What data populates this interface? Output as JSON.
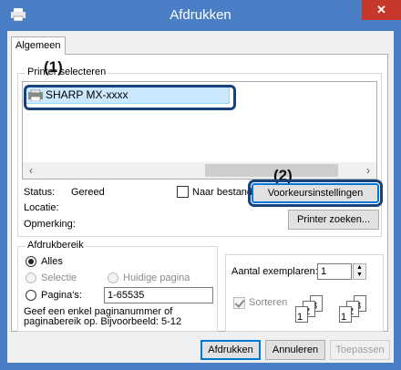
{
  "window": {
    "title": "Afdrukken",
    "close_glyph": "✕"
  },
  "tabs": [
    {
      "label": "Algemeen"
    }
  ],
  "printer_group": {
    "title": "Printer selecteren",
    "marker_1": "(1)",
    "marker_2": "(2)",
    "printers": [
      {
        "name": "SHARP MX-xxxx",
        "selected": true
      }
    ],
    "status_label": "Status:",
    "status_value": "Gereed",
    "location_label": "Locatie:",
    "comment_label": "Opmerking:",
    "print_to_file_label": "Naar bestand",
    "preferences_button": "Voorkeursinstellingen",
    "find_printer_button": "Printer zoeken..."
  },
  "range_group": {
    "title": "Afdrukbereik",
    "all_label": "Alles",
    "selection_label": "Selectie",
    "current_page_label": "Huidige pagina",
    "pages_label": "Pagina's:",
    "pages_value": "1-65535",
    "hint": "Geef een enkel paginanummer of paginabereik op. Bijvoorbeeld: 5-12"
  },
  "copies_group": {
    "copies_label": "Aantal exemplaren:",
    "copies_value": "1",
    "collate_label": "Sorteren",
    "sheet_numbers": [
      "1",
      "2",
      "3"
    ]
  },
  "footer": {
    "print_button": "Afdrukken",
    "cancel_button": "Annuleren",
    "apply_button": "Toepassen"
  }
}
